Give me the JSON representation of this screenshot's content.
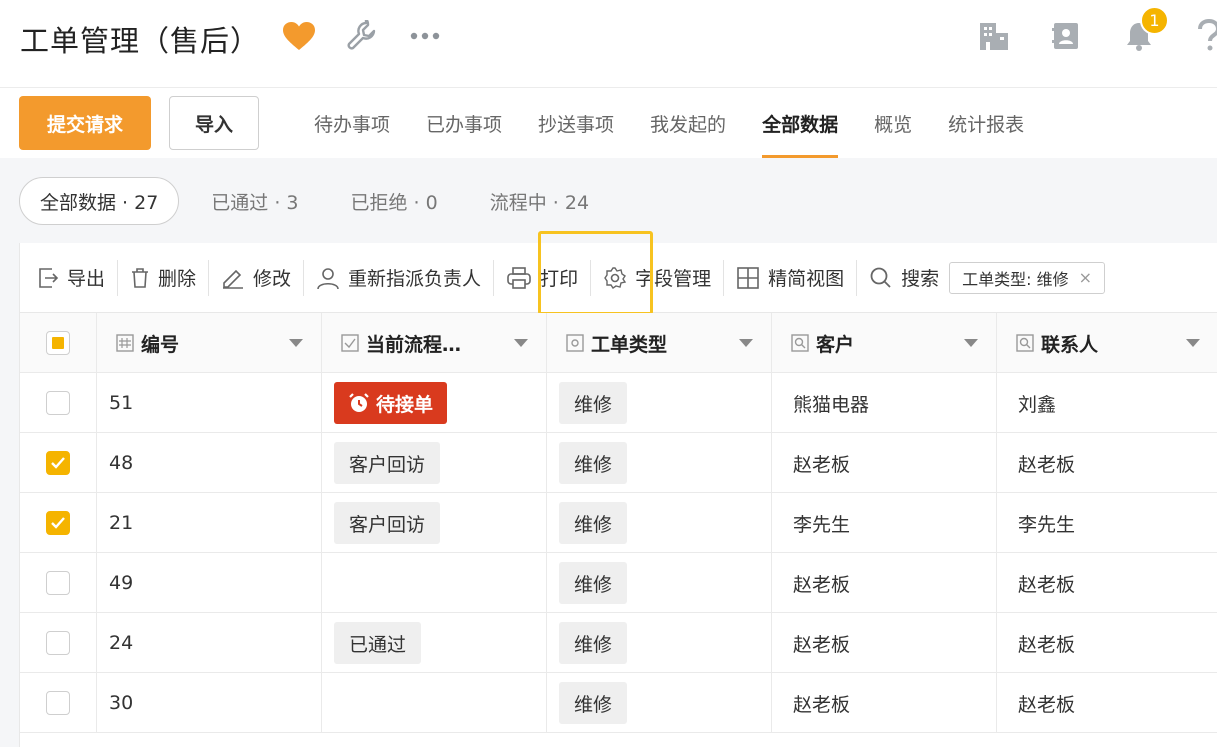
{
  "app": {
    "title": "工单管理（售后）",
    "notification_count": "1"
  },
  "actions": {
    "submit_label": "提交请求",
    "import_label": "导入"
  },
  "tabs": [
    {
      "label": "待办事项"
    },
    {
      "label": "已办事项"
    },
    {
      "label": "抄送事项"
    },
    {
      "label": "我发起的"
    },
    {
      "label": "全部数据",
      "active": true
    },
    {
      "label": "概览"
    },
    {
      "label": "统计报表"
    }
  ],
  "filters": [
    {
      "label": "全部数据 · 27",
      "active": true
    },
    {
      "label": "已通过 · 3"
    },
    {
      "label": "已拒绝 · 0"
    },
    {
      "label": "流程中 · 24"
    }
  ],
  "toolbar": {
    "export": "导出",
    "delete": "删除",
    "edit": "修改",
    "reassign": "重新指派负责人",
    "print": "打印",
    "fields": "字段管理",
    "compact_view": "精简视图",
    "search": "搜索",
    "active_filter": "工单类型: 维修"
  },
  "table": {
    "columns": [
      "编号",
      "当前流程…",
      "工单类型",
      "客户",
      "联系人"
    ],
    "rows": [
      {
        "checked": false,
        "id": "51",
        "flow": "待接单",
        "flow_style": "urgent",
        "type": "维修",
        "customer": "熊猫电器",
        "contact": "刘鑫"
      },
      {
        "checked": true,
        "id": "48",
        "flow": "客户回访",
        "flow_style": "tag",
        "type": "维修",
        "customer": "赵老板",
        "contact": "赵老板"
      },
      {
        "checked": true,
        "id": "21",
        "flow": "客户回访",
        "flow_style": "tag",
        "type": "维修",
        "customer": "李先生",
        "contact": "李先生"
      },
      {
        "checked": false,
        "id": "49",
        "flow": "",
        "flow_style": "none",
        "type": "维修",
        "customer": "赵老板",
        "contact": "赵老板"
      },
      {
        "checked": false,
        "id": "24",
        "flow": "已通过",
        "flow_style": "tag",
        "type": "维修",
        "customer": "赵老板",
        "contact": "赵老板"
      },
      {
        "checked": false,
        "id": "30",
        "flow": "",
        "flow_style": "none",
        "type": "维修",
        "customer": "赵老板",
        "contact": "赵老板"
      }
    ]
  },
  "colors": {
    "accent": "#f39a2d",
    "highlight": "#f7c320",
    "urgent": "#d93a1e",
    "checkbox": "#f5b400"
  }
}
